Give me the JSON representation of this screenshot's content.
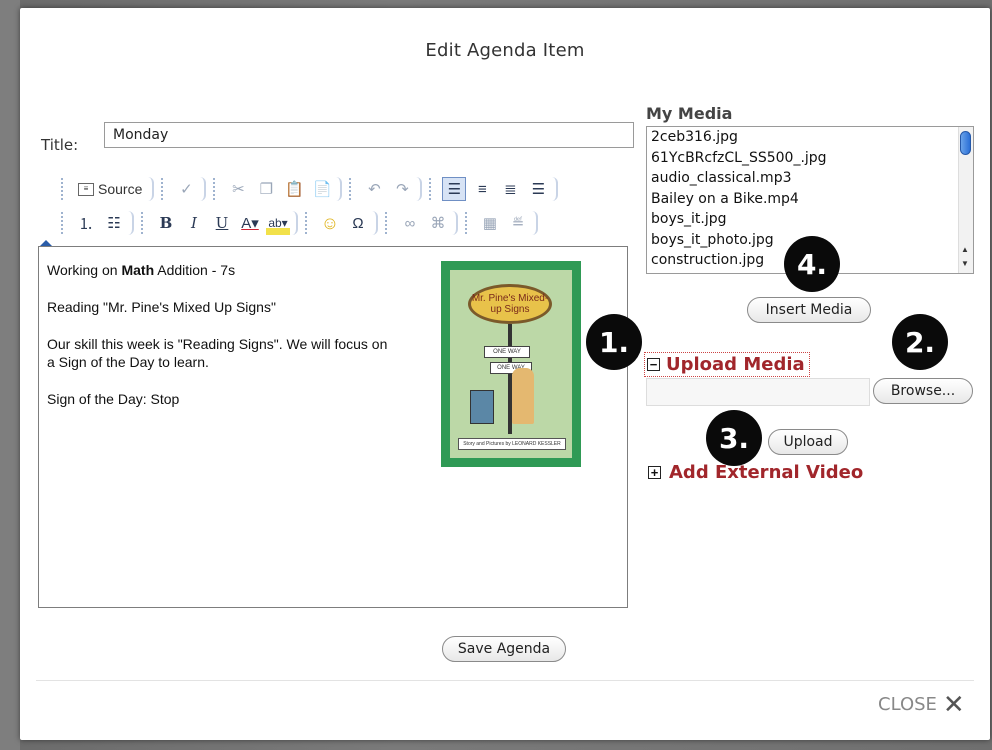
{
  "dialog": {
    "title": "Edit Agenda Item",
    "close_label": "CLOSE",
    "save_label": "Save Agenda"
  },
  "form": {
    "title_label": "Title:",
    "title_value": "Monday"
  },
  "toolbar": {
    "source_label": "Source"
  },
  "editor": {
    "line1_prefix": "Working on ",
    "line1_bold": "Math",
    "line1_suffix": " Addition - 7s",
    "line2": "Reading \"Mr. Pine's Mixed Up Signs\"",
    "line3": "Our skill this week is \"Reading Signs\". We will focus on a Sign of the Day to learn.",
    "line4": "Sign of the Day: Stop",
    "book_title": "Mr. Pine's Mixed-up Signs",
    "book_sign1": "ONE WAY",
    "book_sign2": "ONE WAY",
    "book_credit": "Story and Pictures by LEONARD KESSLER"
  },
  "my_media": {
    "title": "My Media",
    "items": [
      "2ceb316.jpg",
      "61YcBRcfzCL_SS500_.jpg",
      "audio_classical.mp3",
      "Bailey on a Bike.mp4",
      "boys_it.jpg",
      "boys_it_photo.jpg",
      "construction.jpg"
    ],
    "insert_label": "Insert Media"
  },
  "upload": {
    "title": "Upload Media",
    "browse_label": "Browse...",
    "upload_label": "Upload",
    "toggle_symbol": "−"
  },
  "external_video": {
    "title": "Add External Video",
    "toggle_symbol": "+"
  },
  "callouts": [
    "1.",
    "2.",
    "3.",
    "4."
  ],
  "colors": {
    "section_heading": "#a1262b",
    "book_border": "#2f9a55",
    "callout_bg": "#0a0a0a"
  },
  "icons": [
    "source-icon",
    "spellcheck-icon",
    "cut-icon",
    "copy-icon",
    "paste-icon",
    "paste-word-icon",
    "undo-icon",
    "redo-icon",
    "align-left-icon",
    "align-center-icon",
    "align-right-icon",
    "justify-icon",
    "numbered-list-icon",
    "bulleted-list-icon",
    "bold-icon",
    "italic-icon",
    "underline-icon",
    "text-color-icon",
    "highlight-icon",
    "smiley-icon",
    "special-char-icon",
    "link-icon",
    "unlink-icon",
    "table-icon",
    "horizontal-rule-icon",
    "close-icon"
  ]
}
